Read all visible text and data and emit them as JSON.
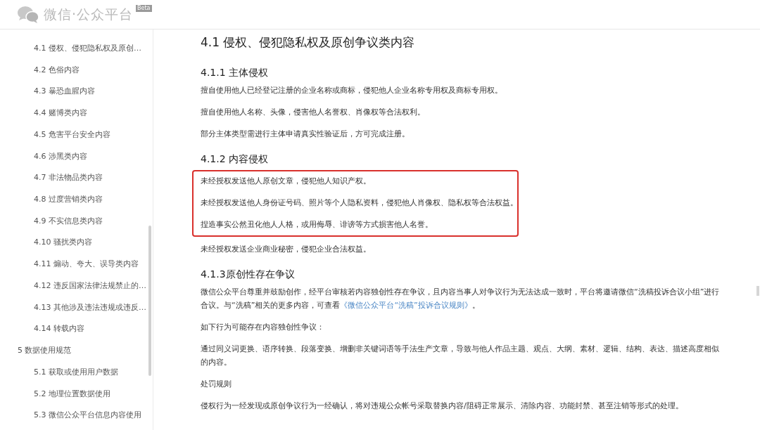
{
  "header": {
    "logo_text": "微信·公众平台",
    "badge": "Beta"
  },
  "sidebar": {
    "groups": [
      {
        "children": [
          {
            "label": "4.1 侵权、侵犯隐私权及原创…"
          },
          {
            "label": "4.2 色俗内容"
          },
          {
            "label": "4.3 暴恐血腥内容"
          },
          {
            "label": "4.4 赌博类内容"
          },
          {
            "label": "4.5 危害平台安全内容"
          },
          {
            "label": "4.6 涉黑类内容"
          },
          {
            "label": "4.7 非法物品类内容"
          },
          {
            "label": "4.8 过度营销类内容"
          },
          {
            "label": "4.9 不实信息类内容"
          },
          {
            "label": "4.10 骚扰类内容"
          },
          {
            "label": "4.11 煽动、夸大、误导类内容"
          },
          {
            "label": "4.12 违反国家法律法规禁止的…"
          },
          {
            "label": "4.13 其他涉及违法违规或违反…"
          },
          {
            "label": "4.14 转载内容"
          }
        ]
      },
      {
        "label": "5 数据使用规范",
        "children": [
          {
            "label": "5.1 获取或使用用户数据"
          },
          {
            "label": "5.2 地理位置数据使用"
          },
          {
            "label": "5.3 微信公众平台信息内容使用"
          }
        ]
      }
    ]
  },
  "article": {
    "title": "4.1 侵权、侵犯隐私权及原创争议类内容",
    "sections": [
      {
        "heading": "4.1.1 主体侵权",
        "blocks": [
          {
            "kind": "paragraph",
            "text": "擅自使用他人已经登记注册的企业名称或商标，侵犯他人企业名称专用权及商标专用权。"
          },
          {
            "kind": "paragraph",
            "text": "擅自使用他人名称、头像，侵害他人名誉权、肖像权等合法权利。"
          },
          {
            "kind": "paragraph",
            "text": "部分主体类型需进行主体申请真实性验证后，方可完成注册。"
          }
        ]
      },
      {
        "heading": "4.1.2 内容侵权",
        "blocks": [
          {
            "kind": "highlight",
            "paragraphs": [
              "未经授权发送他人原创文章，侵犯他人知识产权。",
              "未经授权发送他人身份证号码、照片等个人隐私资料，侵犯他人肖像权、隐私权等合法权益。",
              "捏造事实公然丑化他人人格，或用侮辱、诽谤等方式损害他人名誉。"
            ]
          },
          {
            "kind": "paragraph",
            "text": "未经授权发送企业商业秘密，侵犯企业合法权益。"
          }
        ]
      },
      {
        "heading": "4.1.3原创性存在争议",
        "blocks": [
          {
            "kind": "linked",
            "text": "微信公众平台尊重并鼓励创作，经平台审核若内容独创性存在争议，且内容当事人对争议行为无法达成一致时，平台将邀请微信“洗稿投诉合议小组”进行合议。与“洗稿”相关的更多内容，可查看",
            "link": "《微信公众平台“洗稿”投诉合议规则》",
            "after": "。"
          },
          {
            "kind": "paragraph",
            "text": "如下行为可能存在内容独创性争议："
          },
          {
            "kind": "paragraph",
            "text": "通过同义词更换、语序转换、段落变换、增删非关键词语等手法生产文章，导致与他人作品主题、观点、大纲、素材、逻辑、结构、表达、描述高度相似的内容。"
          },
          {
            "kind": "paragraph",
            "text": "处罚规则"
          },
          {
            "kind": "paragraph",
            "text": "侵权行为一经发现或原创争议行为一经确认，将对违规公众帐号采取替换内容/阻碍正常展示、清除内容、功能封禁、甚至注销等形式的处理。"
          }
        ]
      }
    ]
  }
}
